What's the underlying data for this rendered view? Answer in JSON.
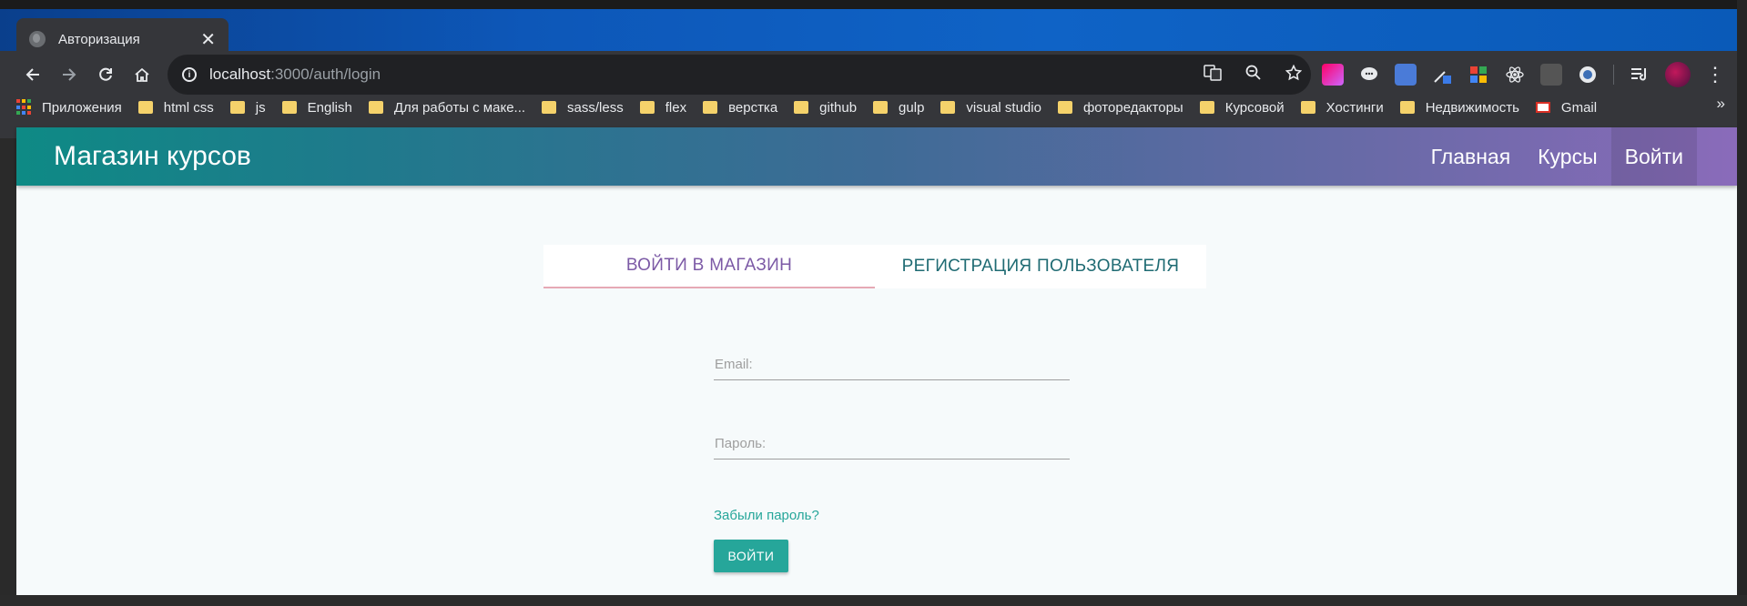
{
  "browser": {
    "tab_title": "Авторизация",
    "close_glyph": "✕",
    "url_host": "localhost",
    "url_path": ":3000/auth/login",
    "bookmarks": [
      {
        "label": "Приложения",
        "type": "apps"
      },
      {
        "label": "html css",
        "type": "folder"
      },
      {
        "label": "js",
        "type": "folder"
      },
      {
        "label": "English",
        "type": "folder"
      },
      {
        "label": "Для работы с маке...",
        "type": "folder"
      },
      {
        "label": "sass/less",
        "type": "folder"
      },
      {
        "label": "flex",
        "type": "folder"
      },
      {
        "label": "верстка",
        "type": "folder"
      },
      {
        "label": "github",
        "type": "folder"
      },
      {
        "label": "gulp",
        "type": "folder"
      },
      {
        "label": "visual studio",
        "type": "folder"
      },
      {
        "label": "фоторедакторы",
        "type": "folder"
      },
      {
        "label": "Курсовой",
        "type": "folder"
      },
      {
        "label": "Хостинги",
        "type": "folder"
      },
      {
        "label": "Недвижимость",
        "type": "folder"
      },
      {
        "label": "Gmail",
        "type": "gmail"
      }
    ],
    "more_glyph": "»"
  },
  "site": {
    "brand": "Магазин курсов",
    "nav": {
      "home": "Главная",
      "courses": "Курсы",
      "login": "Войти"
    },
    "tabs": {
      "login": "ВОЙТИ В МАГАЗИН",
      "register": "РЕГИСТРАЦИЯ ПОЛЬЗОВАТЕЛЯ"
    },
    "form": {
      "email_label": "Email:",
      "password_label": "Пароль:",
      "forgot": "Забыли пароль?",
      "submit": "ВОЙТИ"
    }
  },
  "colors": {
    "accent_teal": "#26a69a",
    "active_tab_purple": "#7c5aa6",
    "nav_gradient_start": "#0e8a85",
    "nav_gradient_end": "#8a6bba"
  }
}
